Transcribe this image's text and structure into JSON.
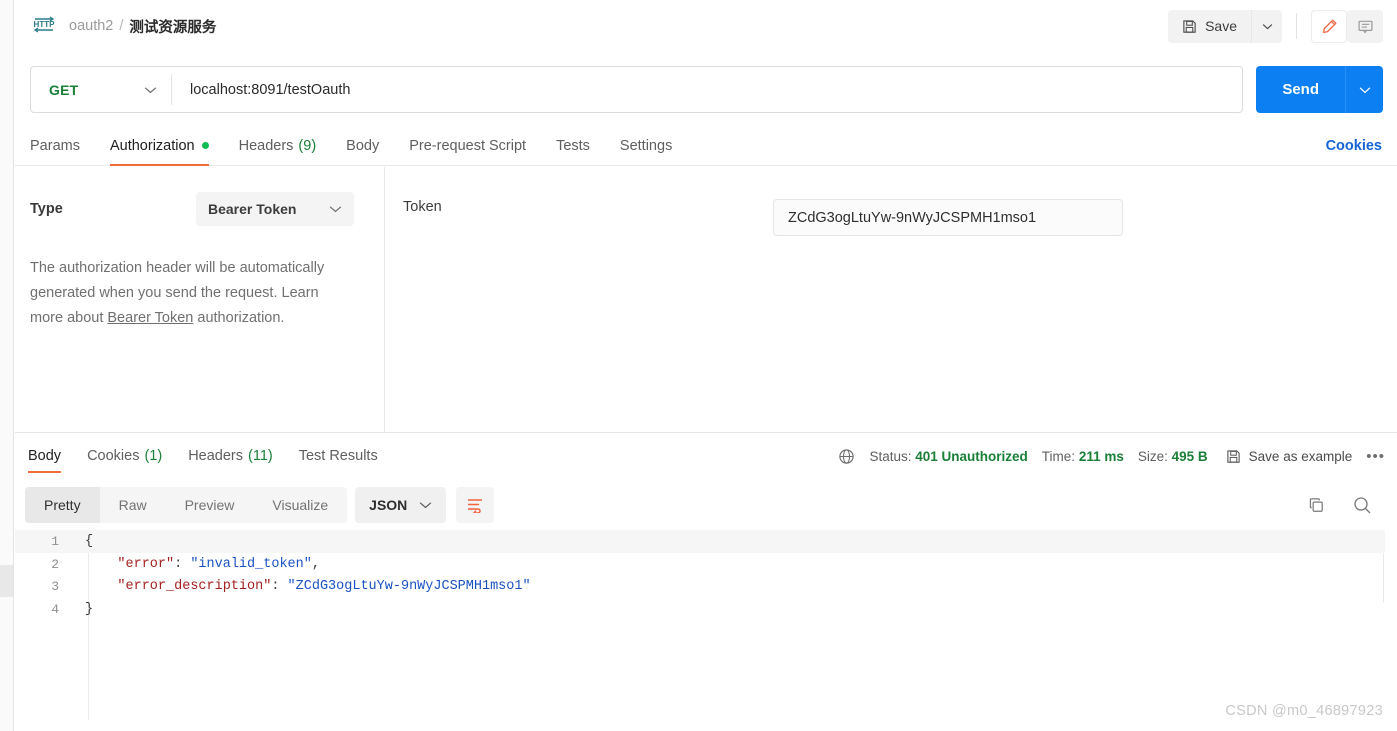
{
  "header": {
    "http_icon": "http-protocol-icon",
    "collection": "oauth2",
    "separator": "/",
    "request_name": "测试资源服务",
    "save_label": "Save",
    "save_caret_icon": "chevron-down-icon",
    "edit_icon": "pencil-icon",
    "comment_icon": "comment-icon"
  },
  "urlbar": {
    "method": "GET",
    "method_caret_icon": "chevron-down-icon",
    "url": "localhost:8091/testOauth",
    "url_placeholder": "Enter request URL",
    "send_label": "Send",
    "send_caret_icon": "chevron-down-icon",
    "send_color": "#0c7ff2",
    "method_color": "#1a7f37"
  },
  "request_tabs": {
    "items": [
      {
        "label": "Params",
        "count": "",
        "active": false,
        "dot": false
      },
      {
        "label": "Authorization",
        "count": "",
        "active": true,
        "dot": true
      },
      {
        "label": "Headers",
        "count": "(9)",
        "active": false,
        "dot": false
      },
      {
        "label": "Body",
        "count": "",
        "active": false,
        "dot": false
      },
      {
        "label": "Pre-request Script",
        "count": "",
        "active": false,
        "dot": false
      },
      {
        "label": "Tests",
        "count": "",
        "active": false,
        "dot": false
      },
      {
        "label": "Settings",
        "count": "",
        "active": false,
        "dot": false
      }
    ],
    "cookies_link": "Cookies",
    "active_underline_color": "#f26b3a",
    "dot_color": "#0cbb52"
  },
  "auth": {
    "type_label": "Type",
    "type_value": "Bearer Token",
    "type_caret_icon": "chevron-down-icon",
    "description_part1": "The authorization header will be automatically generated when you send the request. Learn more about ",
    "description_link": "Bearer Token",
    "description_part2": " authorization.",
    "token_label": "Token",
    "token_value": "ZCdG3ogLtuYw-9nWyJCSPMH1mso1",
    "token_placeholder": "Token"
  },
  "response": {
    "tabs": [
      {
        "label": "Body",
        "count": "",
        "active": true
      },
      {
        "label": "Cookies",
        "count": "(1)",
        "active": false
      },
      {
        "label": "Headers",
        "count": "(11)",
        "active": false
      },
      {
        "label": "Test Results",
        "count": "",
        "active": false
      }
    ],
    "globe_icon": "globe-icon",
    "status_label": "Status:",
    "status_value": "401 Unauthorized",
    "time_label": "Time:",
    "time_value": "211 ms",
    "size_label": "Size:",
    "size_value": "495 B",
    "save_example_icon": "save-disk-icon",
    "save_example_label": "Save as example",
    "more_icon": "more-options-icon",
    "status_color": "#1a7f37"
  },
  "body_toolbar": {
    "views": [
      {
        "label": "Pretty",
        "active": true
      },
      {
        "label": "Raw",
        "active": false
      },
      {
        "label": "Preview",
        "active": false
      },
      {
        "label": "Visualize",
        "active": false
      }
    ],
    "format": "JSON",
    "format_caret_icon": "chevron-down-icon",
    "wrap_icon": "word-wrap-icon",
    "copy_icon": "copy-icon",
    "search_icon": "search-icon"
  },
  "code": {
    "lines": [
      {
        "num": "1",
        "highlight": true,
        "tokens": [
          {
            "t": "p",
            "v": "{"
          }
        ]
      },
      {
        "num": "2",
        "highlight": false,
        "tokens": [
          {
            "t": "p",
            "v": "    "
          },
          {
            "t": "k",
            "v": "\"error\""
          },
          {
            "t": "p",
            "v": ": "
          },
          {
            "t": "s",
            "v": "\"invalid_token\""
          },
          {
            "t": "p",
            "v": ","
          }
        ]
      },
      {
        "num": "3",
        "highlight": false,
        "tokens": [
          {
            "t": "p",
            "v": "    "
          },
          {
            "t": "k",
            "v": "\"error_description\""
          },
          {
            "t": "p",
            "v": ": "
          },
          {
            "t": "s",
            "v": "\"ZCdG3ogLtuYw-9nWyJCSPMH1mso1\""
          }
        ]
      },
      {
        "num": "4",
        "highlight": false,
        "tokens": [
          {
            "t": "p",
            "v": "}"
          }
        ]
      }
    ],
    "key_color": "#a52121",
    "string_color": "#1a52c4"
  },
  "watermark": "CSDN @m0_46897923"
}
